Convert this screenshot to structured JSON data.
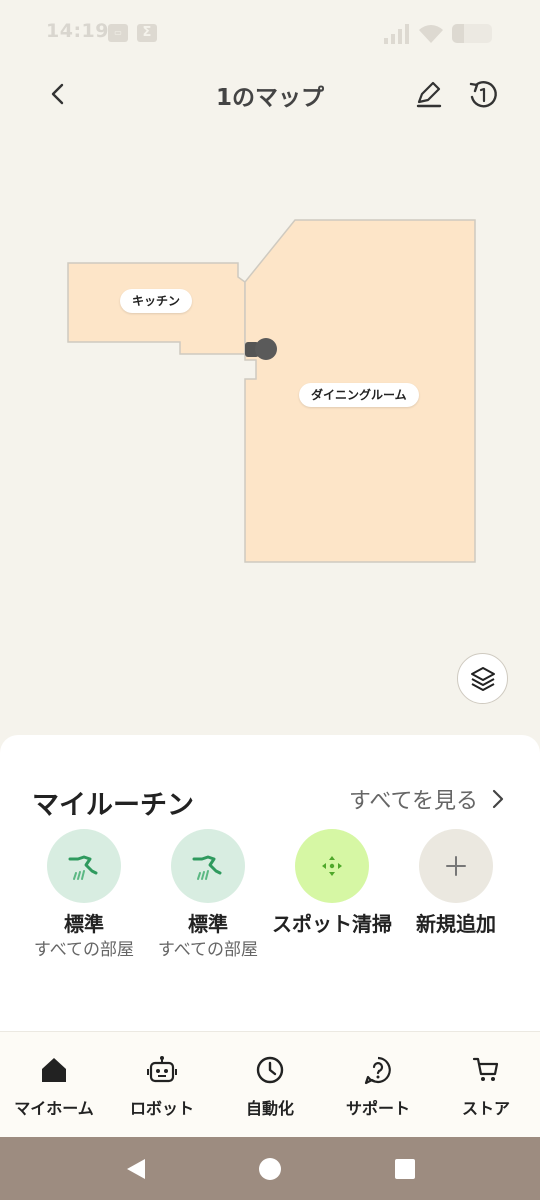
{
  "status_bar": {
    "time": "14:19",
    "icon_a": "box-icon",
    "icon_b": "sigma-icon",
    "icon_b_glyph": "Σ",
    "battery_level": 0.3
  },
  "header": {
    "title": "1のマップ",
    "back_icon": "chevron-left-icon",
    "edit_icon": "pencil-icon",
    "history_icon": "history-icon"
  },
  "map": {
    "room_fill": "#fde5c8",
    "room_border": "#cfcac0",
    "rooms": [
      {
        "id": "kitchen",
        "label": "キッチン"
      },
      {
        "id": "dining",
        "label": "ダイニングルーム"
      }
    ],
    "dock_icon": "dock-icon",
    "layers_icon": "layers-icon"
  },
  "routines": {
    "title": "マイルーチン",
    "see_all": "すべてを見る",
    "items": [
      {
        "name": "標準",
        "sub": "すべての部屋",
        "icon": "fan-icon",
        "color": "#d8ede1"
      },
      {
        "name": "標準",
        "sub": "すべての部屋",
        "icon": "fan-icon",
        "color": "#d8ede1"
      },
      {
        "name": "スポット清掃",
        "sub": "",
        "icon": "spot-icon",
        "color": "#d6f7a4"
      },
      {
        "name": "新規追加",
        "sub": "",
        "icon": "plus-icon",
        "color": "#ebe8e0"
      }
    ]
  },
  "nav": {
    "items": [
      {
        "label": "マイホーム",
        "icon": "home-icon"
      },
      {
        "label": "ロボット",
        "icon": "robot-icon"
      },
      {
        "label": "自動化",
        "icon": "clock-icon"
      },
      {
        "label": "サポート",
        "icon": "help-icon"
      },
      {
        "label": "ストア",
        "icon": "cart-icon"
      }
    ]
  },
  "system_nav": {
    "back_icon": "triangle-back-icon",
    "home_icon": "circle-home-icon",
    "recents_icon": "square-recents-icon"
  }
}
